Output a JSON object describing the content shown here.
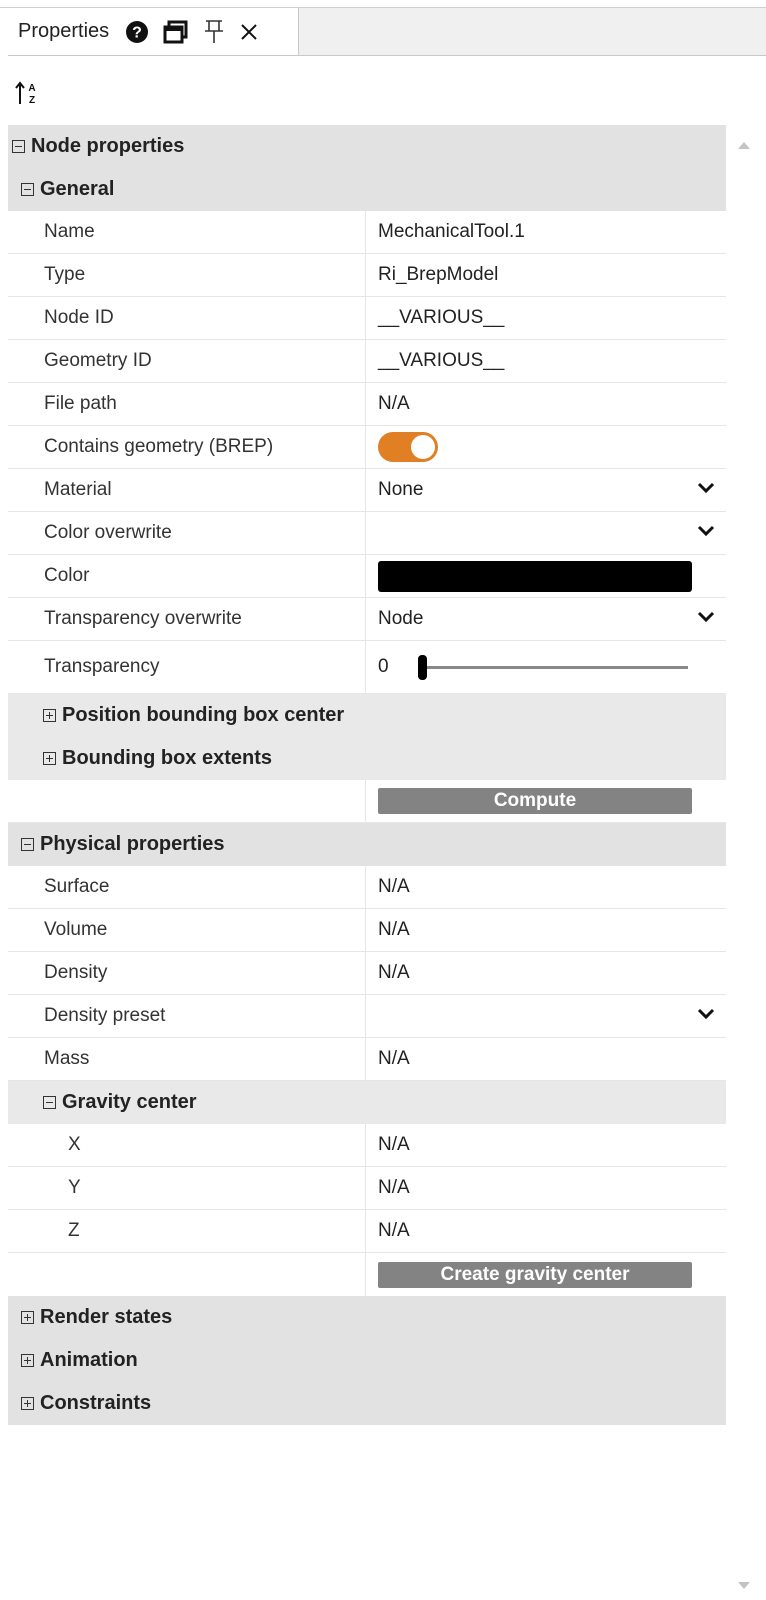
{
  "panel": {
    "tab_title": "Properties",
    "tab_icons": [
      "help-icon",
      "float-window-icon",
      "pin-icon",
      "close-icon"
    ]
  },
  "sort_icon": "sort-az-icon",
  "node_properties": {
    "label": "Node properties",
    "general": {
      "label": "General",
      "name_label": "Name",
      "name_value": "MechanicalTool.1",
      "type_label": "Type",
      "type_value": "Ri_BrepModel",
      "node_id_label": "Node ID",
      "node_id_value": "__VARIOUS__",
      "geometry_id_label": "Geometry ID",
      "geometry_id_value": "__VARIOUS__",
      "file_path_label": "File path",
      "file_path_value": "N/A",
      "contains_geometry_label": "Contains geometry (BREP)",
      "contains_geometry_value": true,
      "material_label": "Material",
      "material_value": "None",
      "color_overwrite_label": "Color overwrite",
      "color_overwrite_value": "",
      "color_label": "Color",
      "color_value": "#000000",
      "transparency_overwrite_label": "Transparency overwrite",
      "transparency_overwrite_value": "Node",
      "transparency_label": "Transparency",
      "transparency_value": "0",
      "position_bbox_label": "Position bounding box center",
      "bbox_extents_label": "Bounding box extents",
      "compute_label": "Compute"
    },
    "physical": {
      "label": "Physical properties",
      "surface_label": "Surface",
      "surface_value": "N/A",
      "volume_label": "Volume",
      "volume_value": "N/A",
      "density_label": "Density",
      "density_value": "N/A",
      "density_preset_label": "Density preset",
      "density_preset_value": "",
      "mass_label": "Mass",
      "mass_value": "N/A",
      "gravity_center": {
        "label": "Gravity center",
        "x_label": "X",
        "x_value": "N/A",
        "y_label": "Y",
        "y_value": "N/A",
        "z_label": "Z",
        "z_value": "N/A"
      },
      "create_gravity_center_label": "Create gravity center"
    },
    "render_states_label": "Render states",
    "animation_label": "Animation",
    "constraints_label": "Constraints"
  },
  "colors": {
    "accent": "#e07f23",
    "group_bg": "#e2e2e2",
    "button_bg": "#838383"
  }
}
